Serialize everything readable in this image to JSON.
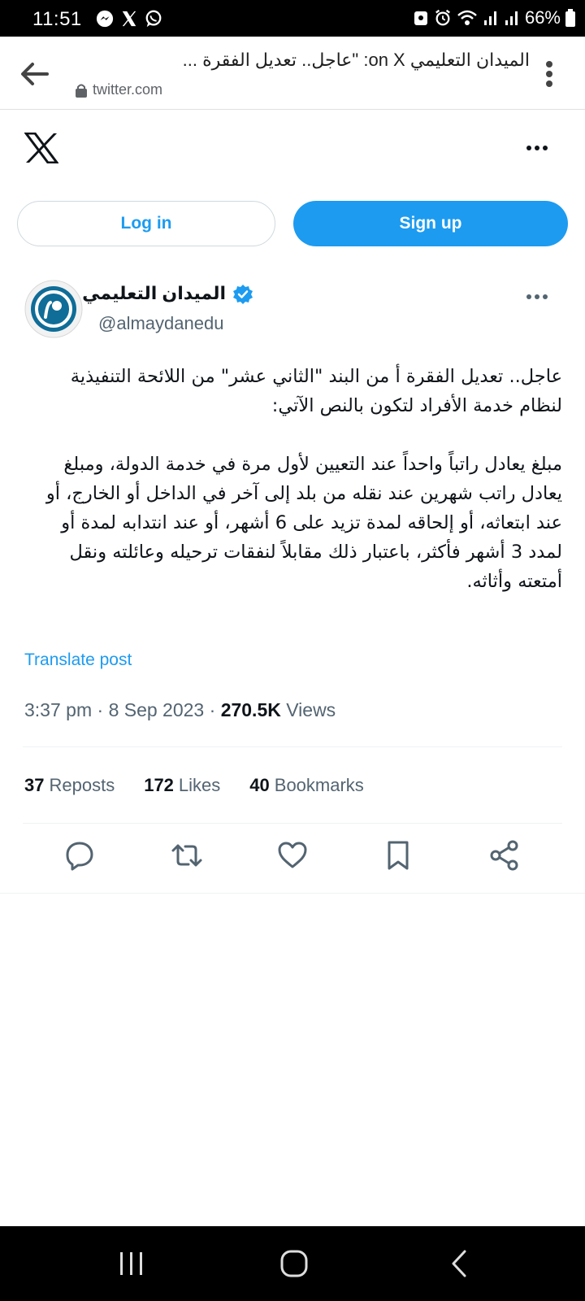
{
  "status_bar": {
    "time": "11:51",
    "battery": "66%"
  },
  "browser": {
    "title": "الميدان التعليمي on X: \"عاجل.. تعديل الفقرة ...",
    "url": "twitter.com"
  },
  "auth": {
    "login_label": "Log in",
    "signup_label": "Sign up"
  },
  "author": {
    "name": "الميدان التعليمي",
    "handle": "@almaydanedu",
    "verified": true
  },
  "tweet": {
    "text": "عاجل.. تعديل الفقرة أ من البند \"الثاني عشر\" من اللائحة التنفيذية لنظام خدمة الأفراد لتكون بالنص الآتي:\n\nمبلغ يعادل راتباً واحداً عند التعيين لأول مرة في خدمة الدولة، ومبلغ يعادل راتب شهرين عند نقله من بلد إلى آخر في الداخل أو الخارج، أو عند ابتعاثه، أو إلحاقه لمدة تزيد على 6 أشهر، أو عند انتدابه لمدة أو لمدد 3 أشهر فأكثر، باعتبار ذلك مقابلاً لنفقات ترحيله وعائلته ونقل أمتعته وأثاثه.",
    "translate_label": "Translate post",
    "time": "3:37 pm",
    "date": "8 Sep 2023",
    "views_count": "270.5K",
    "views_label": "Views"
  },
  "stats": {
    "reposts_count": "37",
    "reposts_label": "Reposts",
    "likes_count": "172",
    "likes_label": "Likes",
    "bookmarks_count": "40",
    "bookmarks_label": "Bookmarks"
  },
  "colors": {
    "accent": "#1d9bf0",
    "text": "#0f1419",
    "muted": "#536471"
  }
}
